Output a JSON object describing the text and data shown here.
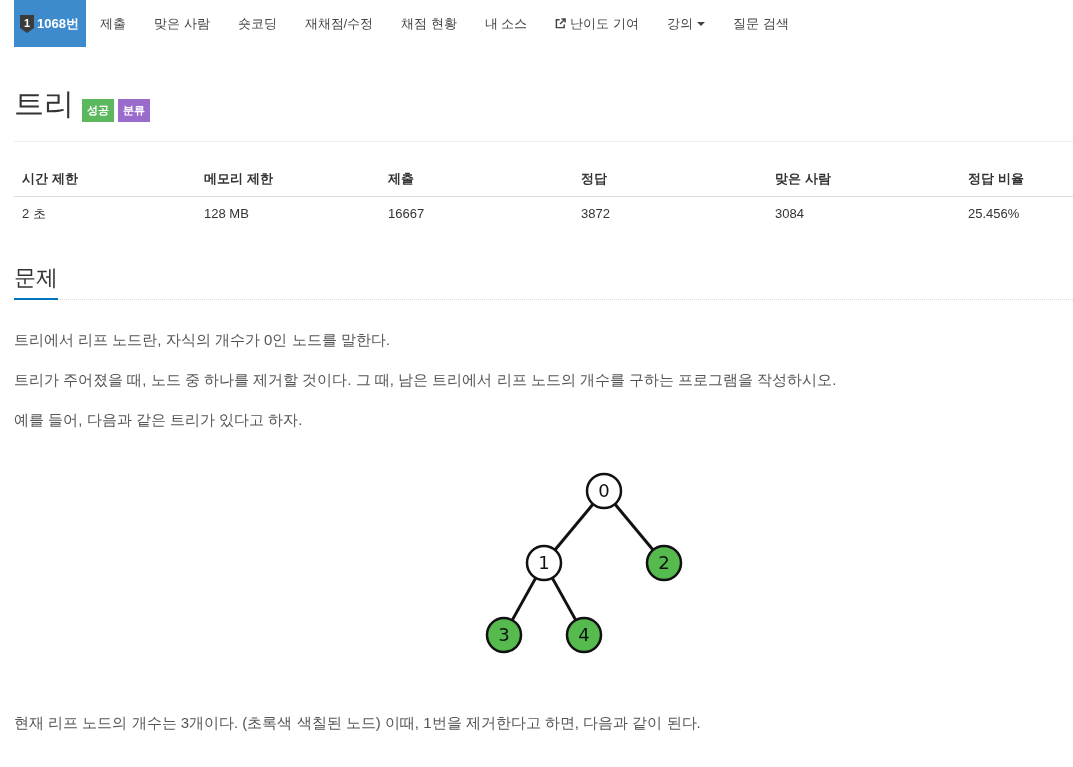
{
  "nav": {
    "items": [
      {
        "label": "1068번",
        "kind": "problem",
        "badge": "1",
        "selected": true
      },
      {
        "label": "제출",
        "kind": "link",
        "selected": false
      },
      {
        "label": "맞은 사람",
        "kind": "link",
        "selected": false
      },
      {
        "label": "숏코딩",
        "kind": "link",
        "selected": false
      },
      {
        "label": "재채점/수정",
        "kind": "link",
        "selected": false
      },
      {
        "label": "채점 현황",
        "kind": "link",
        "selected": false
      },
      {
        "label": "내 소스",
        "kind": "link",
        "selected": false
      },
      {
        "label": "난이도 기여",
        "kind": "external",
        "selected": false
      },
      {
        "label": "강의",
        "kind": "dropdown",
        "selected": false
      },
      {
        "label": "질문 검색",
        "kind": "link",
        "selected": false
      }
    ]
  },
  "problem": {
    "title": "트리",
    "tags": [
      {
        "label": "성공",
        "color": "#5cb85c"
      },
      {
        "label": "분류",
        "color": "#9b6bcc"
      }
    ]
  },
  "stats": {
    "columns": [
      "시간 제한",
      "메모리 제한",
      "제출",
      "정답",
      "맞은 사람",
      "정답 비율"
    ],
    "rows": [
      [
        "2 초",
        "128 MB",
        "16667",
        "3872",
        "3084",
        "25.456%"
      ]
    ]
  },
  "statement": {
    "heading": "문제",
    "blocks": [
      {
        "kind": "text",
        "text": "트리에서 리프 노드란, 자식의 개수가 0인 노드를 말한다."
      },
      {
        "kind": "text",
        "text": "트리가 주어졌을 때, 노드 중 하나를 제거할 것이다. 그 때, 남은 트리에서 리프 노드의 개수를 구하는 프로그램을 작성하시오."
      },
      {
        "kind": "text",
        "text": "예를 들어, 다음과 같은 트리가 있다고 하자."
      },
      {
        "kind": "tree",
        "root": {
          "label": "0",
          "children": [
            {
              "label": "1",
              "children": [
                {
                  "label": "3",
                  "color": "#55bb4f"
                },
                {
                  "label": "4",
                  "color": "#55bb4f"
                }
              ]
            },
            {
              "label": "2",
              "color": "#55bb4f"
            }
          ]
        }
      },
      {
        "kind": "text",
        "text": "현재 리프 노드의 개수는 3개이다. (초록색 색칠된 노드) 이때, 1번을 제거한다고 하면, 다음과 같이 된다."
      }
    ]
  }
}
